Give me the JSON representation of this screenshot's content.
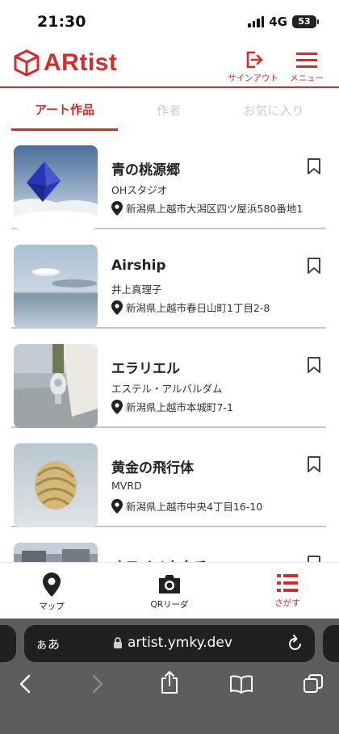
{
  "status": {
    "time": "21:30",
    "network": "4G",
    "battery": "53"
  },
  "header": {
    "logo_text": "ARtist",
    "signout_label": "サインアウト",
    "menu_label": "メニュー",
    "accent_color": "#d52b2b"
  },
  "tabs": [
    {
      "label": "アート作品",
      "active": true
    },
    {
      "label": "作者",
      "active": false
    },
    {
      "label": "お気に入り",
      "active": false
    }
  ],
  "artworks": [
    {
      "title": "青の桃源郷",
      "artist": "OHスタジオ",
      "address": "新潟県上越市大潟区四ツ屋浜580番地1"
    },
    {
      "title": "Airship",
      "artist": "井上真理子",
      "address": "新潟県上越市春日山町1丁目2-8"
    },
    {
      "title": "エラリエル",
      "artist": "エステル・アルバルダム",
      "address": "新潟県上越市本城町7-1"
    },
    {
      "title": "黄金の飛行体",
      "artist": "MVRD",
      "address": "新潟県上越市中央4丁目16-10"
    },
    {
      "title": "オモイノカタチ",
      "artist": "",
      "address": ""
    }
  ],
  "bottom_nav": {
    "map_label": "マップ",
    "qr_label": "QRリーダ",
    "search_label": "さがす"
  },
  "browser": {
    "aa_label": "ぁあ",
    "url": "artist.ymky.dev"
  }
}
